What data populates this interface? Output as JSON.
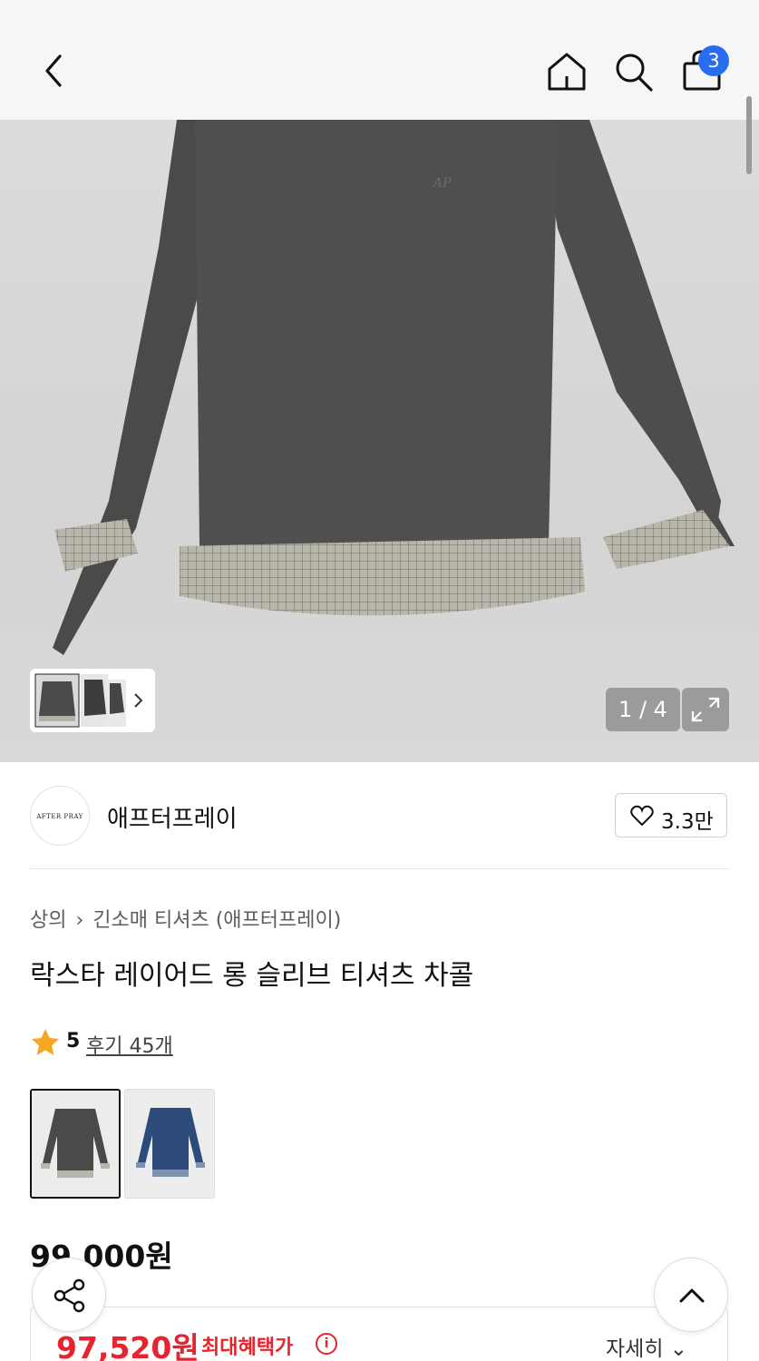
{
  "header": {
    "cart_count": "3",
    "icons": [
      "back-icon",
      "home-icon",
      "search-icon",
      "cart-bag-icon"
    ]
  },
  "gallery": {
    "counter": "1 / 4",
    "image_alt": "long sleeve layered t-shirt charcoal",
    "embroidery_text": "AP"
  },
  "brand": {
    "logo_text": "AFTER PRAY",
    "name": "애프터프레이",
    "likes": "3.3만"
  },
  "breadcrumb": {
    "category": "상의",
    "subcategory": "긴소매 티셔츠 (애프터프레이)"
  },
  "product": {
    "title": "락스타 레이어드 롱 슬리브 티셔츠 차콜",
    "rating": "5",
    "reviews": "후기 45개",
    "price": "99,000원",
    "colors": [
      "charcoal",
      "navy"
    ]
  },
  "benefit": {
    "price": "97,520원",
    "label": "최대혜택가",
    "info_icon": "i",
    "detail": "자세히"
  },
  "colors": {
    "accent_blue": "#2a6cf0",
    "sale_red": "#e6242d",
    "star": "#f5a623"
  }
}
